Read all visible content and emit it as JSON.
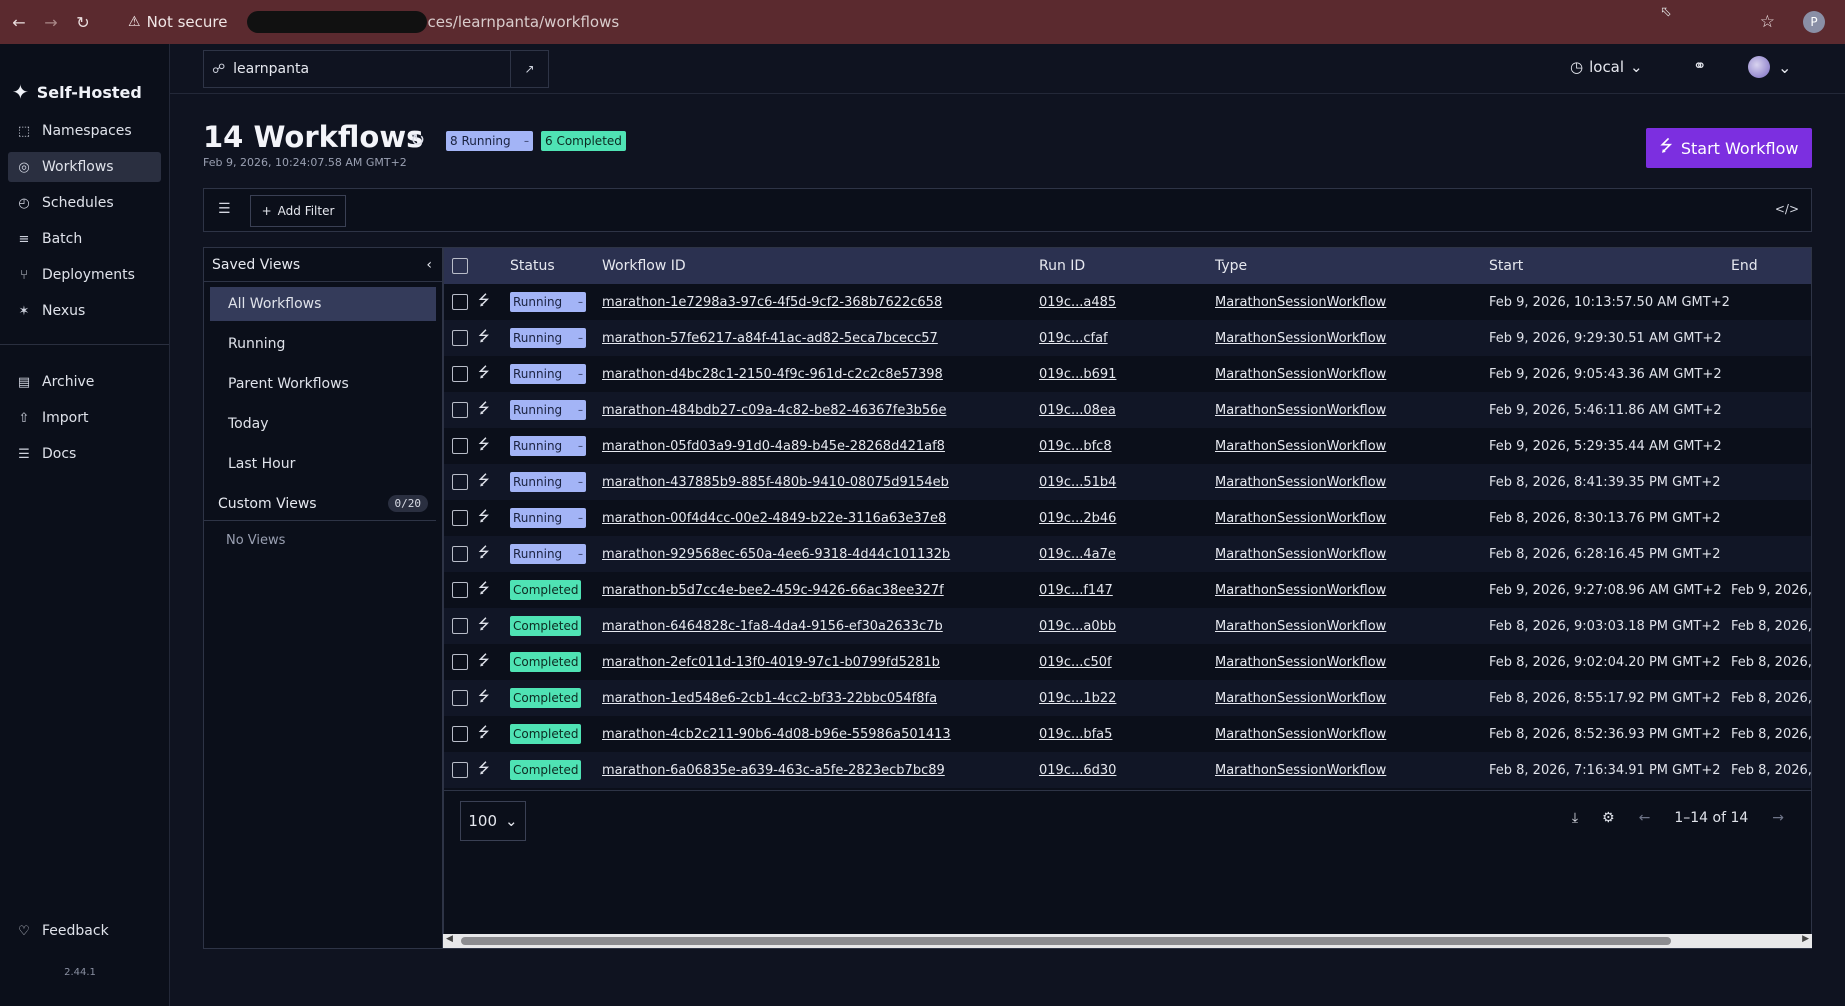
{
  "browser": {
    "security": "Not secure",
    "url_tail": "ces/learnpanta/workflows",
    "profile_initial": "P"
  },
  "sidebar": {
    "brand": "Self-Hosted",
    "items": [
      {
        "label": "Namespaces",
        "icon": "cube-icon"
      },
      {
        "label": "Workflows",
        "icon": "workflows-icon",
        "active": true
      },
      {
        "label": "Schedules",
        "icon": "schedule-icon"
      },
      {
        "label": "Batch",
        "icon": "stack-icon"
      },
      {
        "label": "Deployments",
        "icon": "deploy-icon"
      },
      {
        "label": "Nexus",
        "icon": "nexus-icon"
      }
    ],
    "items2": [
      {
        "label": "Archive",
        "icon": "archive-icon"
      },
      {
        "label": "Import",
        "icon": "import-icon"
      },
      {
        "label": "Docs",
        "icon": "docs-icon"
      }
    ],
    "feedback": "Feedback",
    "version": "2.44.1"
  },
  "topbar": {
    "namespace": "learnpanta",
    "timezone": "local"
  },
  "header": {
    "title": "14 Workflows",
    "running_badge": "8 Running",
    "completed_badge": "6 Completed",
    "timestamp": "Feb 9, 2026, 10:24:07.58 AM GMT+2",
    "start_button": "Start Workflow"
  },
  "filter": {
    "add_filter": "Add Filter"
  },
  "views": {
    "title": "Saved Views",
    "items": [
      "All Workflows",
      "Running",
      "Parent Workflows",
      "Today",
      "Last Hour"
    ],
    "custom_title": "Custom Views",
    "custom_count": "0/20",
    "no_views": "No Views"
  },
  "table": {
    "columns": {
      "status": "Status",
      "workflow_id": "Workflow ID",
      "run_id": "Run ID",
      "type": "Type",
      "start": "Start",
      "end": "End"
    },
    "rows": [
      {
        "status": "Running",
        "id": "marathon-1e7298a3-97c6-4f5d-9cf2-368b7622c658",
        "run": "019c...a485",
        "type": "MarathonSessionWorkflow",
        "start": "Feb 9, 2026, 10:13:57.50 AM GMT+2",
        "end": ""
      },
      {
        "status": "Running",
        "id": "marathon-57fe6217-a84f-41ac-ad82-5eca7bcecc57",
        "run": "019c...cfaf",
        "type": "MarathonSessionWorkflow",
        "start": "Feb 9, 2026, 9:29:30.51 AM GMT+2",
        "end": ""
      },
      {
        "status": "Running",
        "id": "marathon-d4bc28c1-2150-4f9c-961d-c2c2c8e57398",
        "run": "019c...b691",
        "type": "MarathonSessionWorkflow",
        "start": "Feb 9, 2026, 9:05:43.36 AM GMT+2",
        "end": ""
      },
      {
        "status": "Running",
        "id": "marathon-484bdb27-c09a-4c82-be82-46367fe3b56e",
        "run": "019c...08ea",
        "type": "MarathonSessionWorkflow",
        "start": "Feb 9, 2026, 5:46:11.86 AM GMT+2",
        "end": ""
      },
      {
        "status": "Running",
        "id": "marathon-05fd03a9-91d0-4a89-b45e-28268d421af8",
        "run": "019c...bfc8",
        "type": "MarathonSessionWorkflow",
        "start": "Feb 9, 2026, 5:29:35.44 AM GMT+2",
        "end": ""
      },
      {
        "status": "Running",
        "id": "marathon-437885b9-885f-480b-9410-08075d9154eb",
        "run": "019c...51b4",
        "type": "MarathonSessionWorkflow",
        "start": "Feb 8, 2026, 8:41:39.35 PM GMT+2",
        "end": ""
      },
      {
        "status": "Running",
        "id": "marathon-00f4d4cc-00e2-4849-b22e-3116a63e37e8",
        "run": "019c...2b46",
        "type": "MarathonSessionWorkflow",
        "start": "Feb 8, 2026, 8:30:13.76 PM GMT+2",
        "end": ""
      },
      {
        "status": "Running",
        "id": "marathon-929568ec-650a-4ee6-9318-4d44c101132b",
        "run": "019c...4a7e",
        "type": "MarathonSessionWorkflow",
        "start": "Feb 8, 2026, 6:28:16.45 PM GMT+2",
        "end": ""
      },
      {
        "status": "Completed",
        "id": "marathon-b5d7cc4e-bee2-459c-9426-66ac38ee327f",
        "run": "019c...f147",
        "type": "MarathonSessionWorkflow",
        "start": "Feb 9, 2026, 9:27:08.96 AM GMT+2",
        "end": "Feb 9, 2026,"
      },
      {
        "status": "Completed",
        "id": "marathon-6464828c-1fa8-4da4-9156-ef30a2633c7b",
        "run": "019c...a0bb",
        "type": "MarathonSessionWorkflow",
        "start": "Feb 8, 2026, 9:03:03.18 PM GMT+2",
        "end": "Feb 8, 2026,"
      },
      {
        "status": "Completed",
        "id": "marathon-2efc011d-13f0-4019-97c1-b0799fd5281b",
        "run": "019c...c50f",
        "type": "MarathonSessionWorkflow",
        "start": "Feb 8, 2026, 9:02:04.20 PM GMT+2",
        "end": "Feb 8, 2026,"
      },
      {
        "status": "Completed",
        "id": "marathon-1ed548e6-2cb1-4cc2-bf33-22bbc054f8fa",
        "run": "019c...1b22",
        "type": "MarathonSessionWorkflow",
        "start": "Feb 8, 2026, 8:55:17.92 PM GMT+2",
        "end": "Feb 8, 2026,"
      },
      {
        "status": "Completed",
        "id": "marathon-4cb2c211-90b6-4d08-b96e-55986a501413",
        "run": "019c...bfa5",
        "type": "MarathonSessionWorkflow",
        "start": "Feb 8, 2026, 8:52:36.93 PM GMT+2",
        "end": "Feb 8, 2026,"
      },
      {
        "status": "Completed",
        "id": "marathon-6a06835e-a639-463c-a5fe-2823ecb7bc89",
        "run": "019c...6d30",
        "type": "MarathonSessionWorkflow",
        "start": "Feb 8, 2026, 7:16:34.91 PM GMT+2",
        "end": "Feb 8, 2026,"
      }
    ]
  },
  "pagination": {
    "page_size": "100",
    "range": "1–14 of 14"
  },
  "colors": {
    "accent": "#7c2fe0",
    "running": "#a3b4f6",
    "completed": "#4fe3b4"
  }
}
